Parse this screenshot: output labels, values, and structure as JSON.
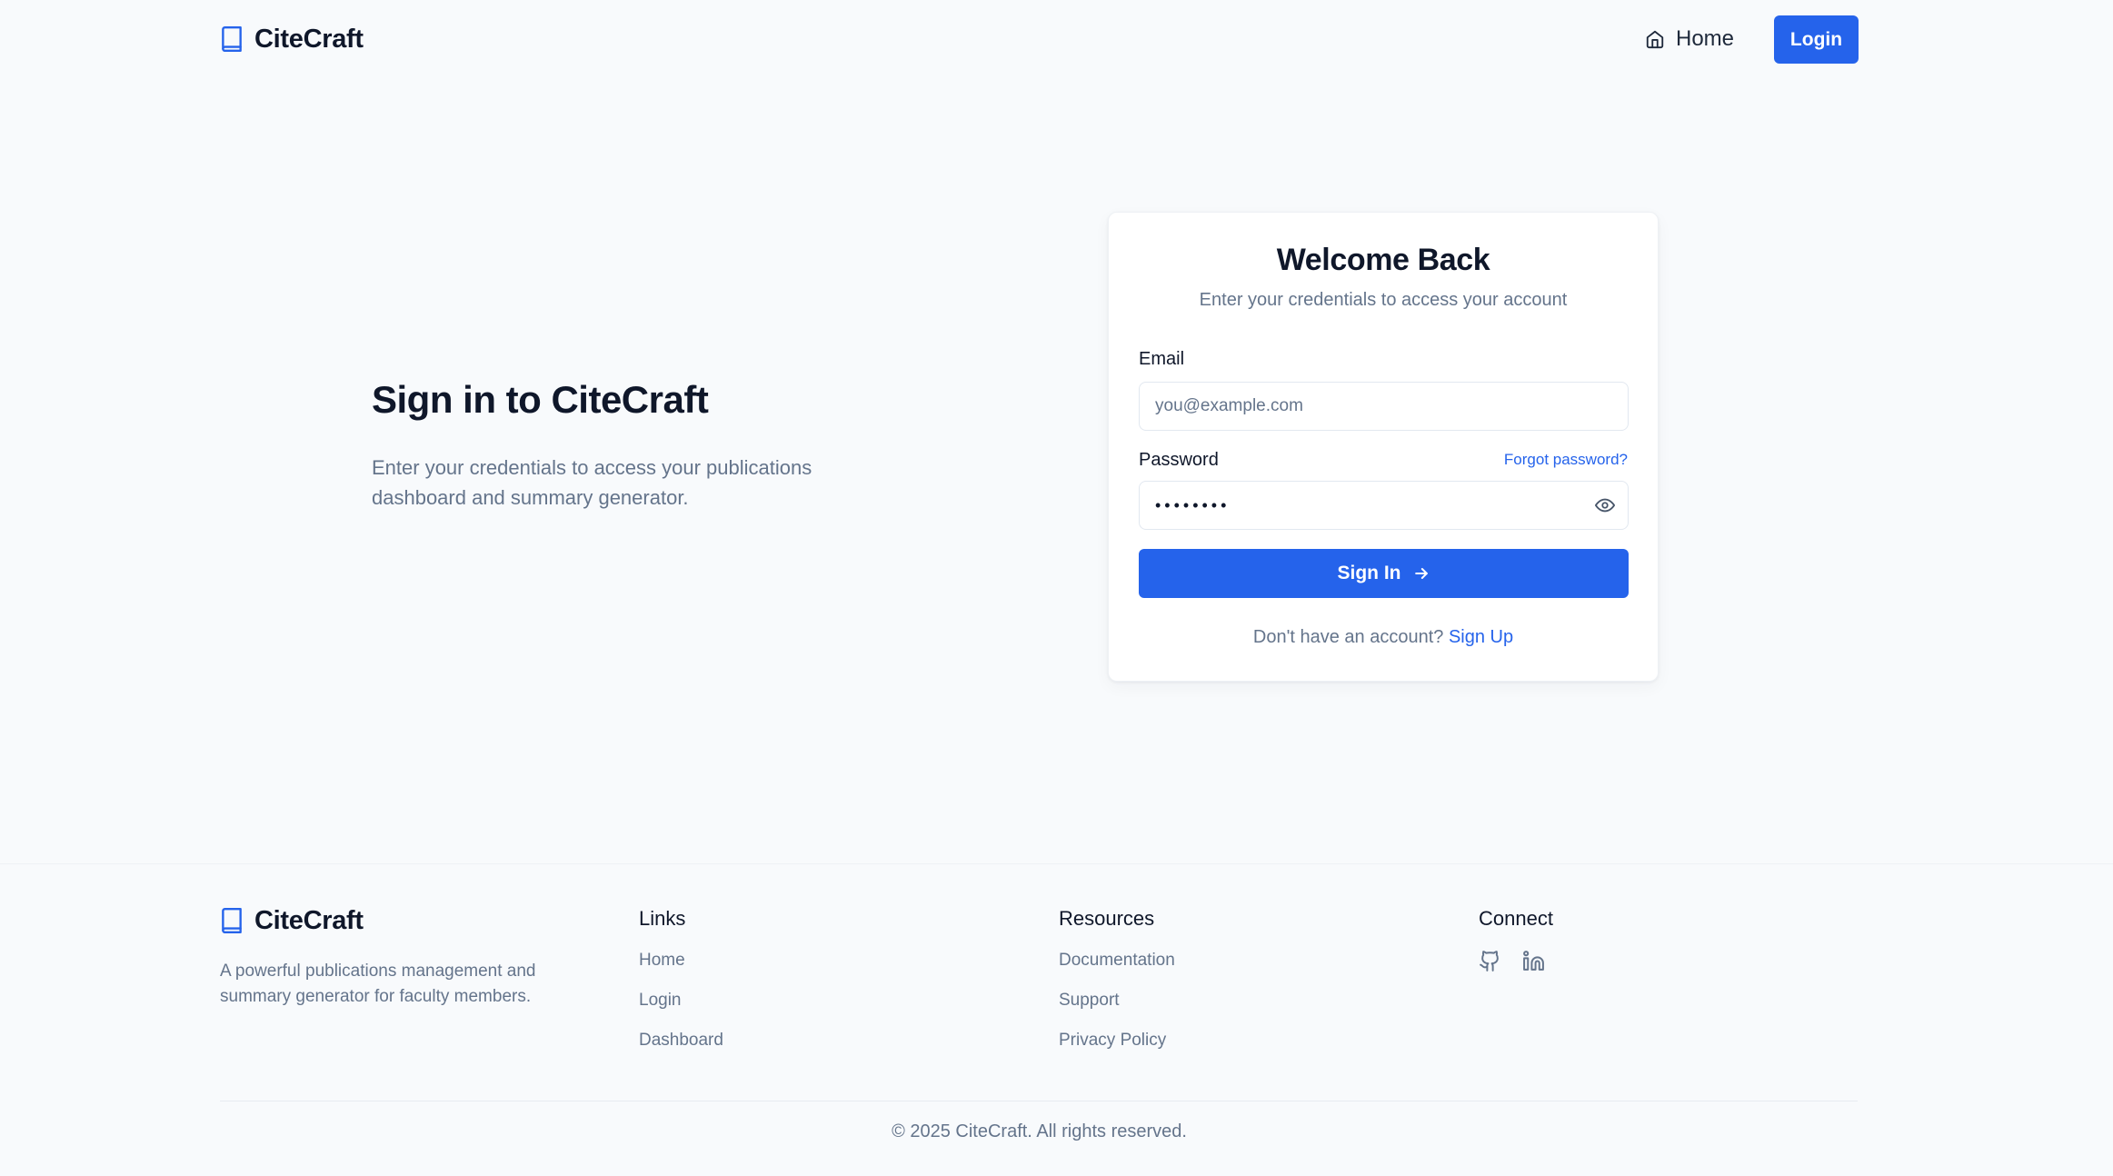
{
  "header": {
    "brand": "CiteCraft",
    "nav_home": "Home",
    "nav_login": "Login"
  },
  "hero": {
    "title": "Sign in to CiteCraft",
    "description": "Enter your credentials to access your publications dashboard and summary generator."
  },
  "login_card": {
    "title": "Welcome Back",
    "subtitle": "Enter your credentials to access your account",
    "email_label": "Email",
    "email_placeholder": "you@example.com",
    "email_value": "",
    "password_label": "Password",
    "password_value": "••••••••",
    "forgot_password": "Forgot password?",
    "submit_label": "Sign In",
    "signup_prompt": "Don't have an account?",
    "signup_link": "Sign Up"
  },
  "footer": {
    "brand": "CiteCraft",
    "description": "A powerful publications management and summary generator for faculty members.",
    "columns": [
      {
        "heading": "Links",
        "items": [
          "Home",
          "Login",
          "Dashboard"
        ]
      },
      {
        "heading": "Resources",
        "items": [
          "Documentation",
          "Support",
          "Privacy Policy"
        ]
      },
      {
        "heading": "Connect",
        "icons": [
          "github-icon",
          "linkedin-icon"
        ]
      }
    ],
    "copyright": "© 2025 CiteCraft. All rights reserved."
  },
  "colors": {
    "primary": "#2563eb",
    "background": "#f8fafc",
    "text": "#0f172a",
    "muted": "#64748b"
  }
}
